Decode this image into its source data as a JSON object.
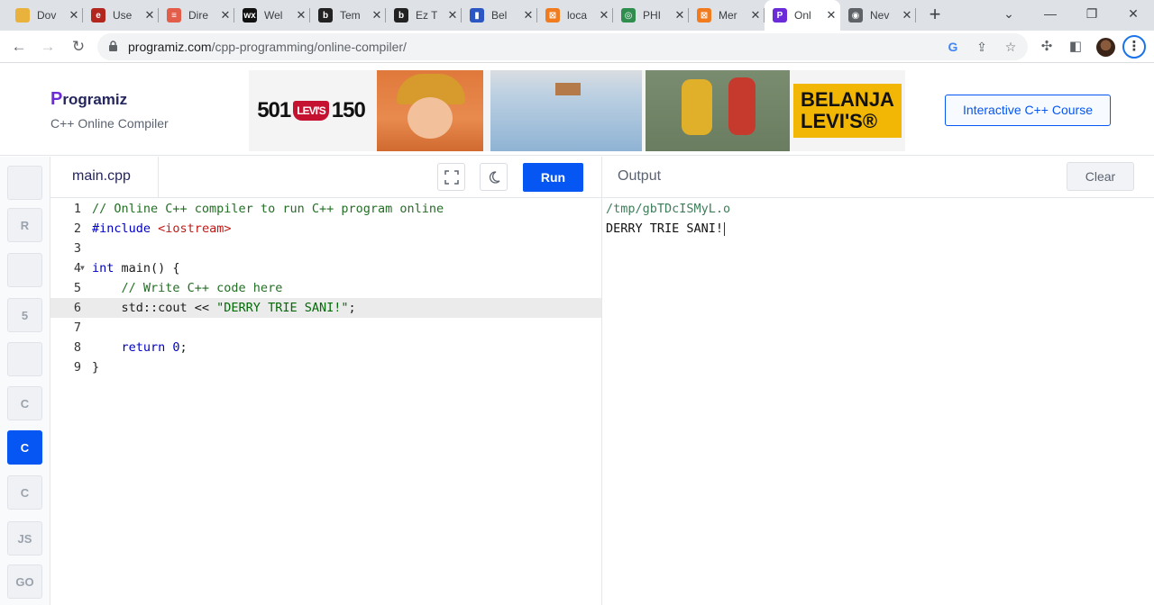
{
  "browser": {
    "tabs": [
      {
        "title": "Dov",
        "favicon": "folder-icon",
        "color": "#e8b23c",
        "glyph": ""
      },
      {
        "title": "Use",
        "favicon": "e-icon",
        "color": "#b3261e",
        "glyph": "e"
      },
      {
        "title": "Dire",
        "favicon": "list-icon",
        "color": "#e25d4a",
        "glyph": "≡"
      },
      {
        "title": "Wel",
        "favicon": "wix-icon",
        "color": "#111111",
        "glyph": "wx"
      },
      {
        "title": "Tem",
        "favicon": "b-icon",
        "color": "#222222",
        "glyph": "b"
      },
      {
        "title": "Ez T",
        "favicon": "b-icon",
        "color": "#222222",
        "glyph": "b"
      },
      {
        "title": "Bel",
        "favicon": "flag-icon",
        "color": "#2b56c4",
        "glyph": "▮"
      },
      {
        "title": "loca",
        "favicon": "xampp-icon",
        "color": "#f07c1f",
        "glyph": "⊠"
      },
      {
        "title": "PHI",
        "favicon": "refresh-icon",
        "color": "#2f8e4e",
        "glyph": "◎"
      },
      {
        "title": "Mer",
        "favicon": "xampp-icon",
        "color": "#f07c1f",
        "glyph": "⊠"
      },
      {
        "title": "Onl",
        "favicon": "programiz-icon",
        "color": "#6c2bd9",
        "glyph": "P"
      },
      {
        "title": "Nev",
        "favicon": "chrome-icon",
        "color": "#5f6368",
        "glyph": "◉"
      }
    ],
    "url_host": "programiz.com",
    "url_path": "/cpp-programming/online-compiler/"
  },
  "header": {
    "logo_initial": "P",
    "logo_text": "rogramiz",
    "subtitle": "C++ Online Compiler",
    "ad": {
      "left_number": "501",
      "brand": "LEVI'S",
      "right_number": "150",
      "cta_line1": "BELANJA",
      "cta_line2": "LEVI'S®"
    },
    "course_button": "Interactive C++ Course"
  },
  "languages": [
    {
      "name": "python",
      "label": "",
      "active": false
    },
    {
      "name": "r",
      "label": "R",
      "active": false
    },
    {
      "name": "sql",
      "label": "",
      "active": false
    },
    {
      "name": "html",
      "label": "5",
      "active": false
    },
    {
      "name": "java",
      "label": "",
      "active": false
    },
    {
      "name": "c",
      "label": "C",
      "active": false
    },
    {
      "name": "cpp",
      "label": "C",
      "active": true
    },
    {
      "name": "csharp",
      "label": "C",
      "active": false
    },
    {
      "name": "js",
      "label": "JS",
      "active": false
    },
    {
      "name": "go",
      "label": "GO",
      "active": false
    }
  ],
  "editor": {
    "filename": "main.cpp",
    "run_label": "Run",
    "lines": [
      {
        "n": "1",
        "comment": "// Online C++ compiler to run C++ program online"
      },
      {
        "n": "2",
        "kw": "#include",
        "inc": "<iostream>"
      },
      {
        "n": "3"
      },
      {
        "n": "4",
        "kw": "int",
        "rest": " main() {"
      },
      {
        "n": "5",
        "comment": "    // Write C++ code here"
      },
      {
        "n": "6",
        "pre": "    std::cout << ",
        "str": "\"DERRY TRIE SANI!\"",
        "post": ";"
      },
      {
        "n": "7"
      },
      {
        "n": "8",
        "kw": "    return",
        "num": " 0",
        "post": ";"
      },
      {
        "n": "9",
        "rest": "}"
      }
    ]
  },
  "output": {
    "title": "Output",
    "clear_label": "Clear",
    "path": "/tmp/gbTDcISMyL.o",
    "text": "DERRY TRIE SANI!"
  }
}
